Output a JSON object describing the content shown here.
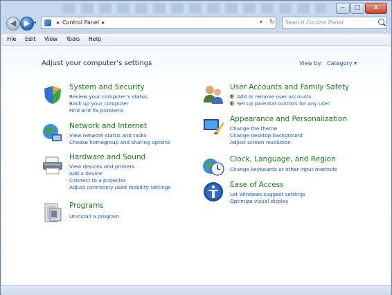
{
  "window": {
    "min": "‒",
    "max": "□",
    "close": "x"
  },
  "nav": {
    "back": "◀",
    "forward": "▶",
    "dropdown": "▾"
  },
  "address": {
    "sep1": "▸",
    "path": "Control Panel",
    "sep2": "▸",
    "dropdown": "▾",
    "refresh": "↻"
  },
  "search": {
    "placeholder": "Search Control Panel"
  },
  "menu": [
    "File",
    "Edit",
    "View",
    "Tools",
    "Help"
  ],
  "page": {
    "heading": "Adjust your computer's settings",
    "view_by_label": "View by:",
    "view_by_value": "Category ▾"
  },
  "categories": [
    {
      "title": "System and Security",
      "icon": "shield-pc-icon",
      "links": [
        "Review your computer's status",
        "Back up your computer",
        "Find and fix problems"
      ]
    },
    {
      "title": "Network and Internet",
      "icon": "globe-network-icon",
      "links": [
        "View network status and tasks",
        "Choose homegroup and sharing options"
      ]
    },
    {
      "title": "Hardware and Sound",
      "icon": "printer-icon",
      "links": [
        "View devices and printers",
        "Add a device",
        "Connect to a projector",
        "Adjust commonly used mobility settings"
      ]
    },
    {
      "title": "Programs",
      "icon": "programs-icon",
      "links": [
        "Uninstall a program"
      ]
    },
    {
      "title": "User Accounts and Family Safety",
      "icon": "users-icon",
      "links": [
        "Add or remove user accounts",
        "Set up parental controls for any user"
      ]
    },
    {
      "title": "Appearance and Personalization",
      "icon": "appearance-icon",
      "links": [
        "Change the theme",
        "Change desktop background",
        "Adjust screen resolution"
      ]
    },
    {
      "title": "Clock, Language, and Region",
      "icon": "clock-globe-icon",
      "links": [
        "Change keyboards or other input methods"
      ]
    },
    {
      "title": "Ease of Access",
      "icon": "ease-of-access-icon",
      "links": [
        "Let Windows suggest settings",
        "Optimize visual display"
      ]
    }
  ]
}
